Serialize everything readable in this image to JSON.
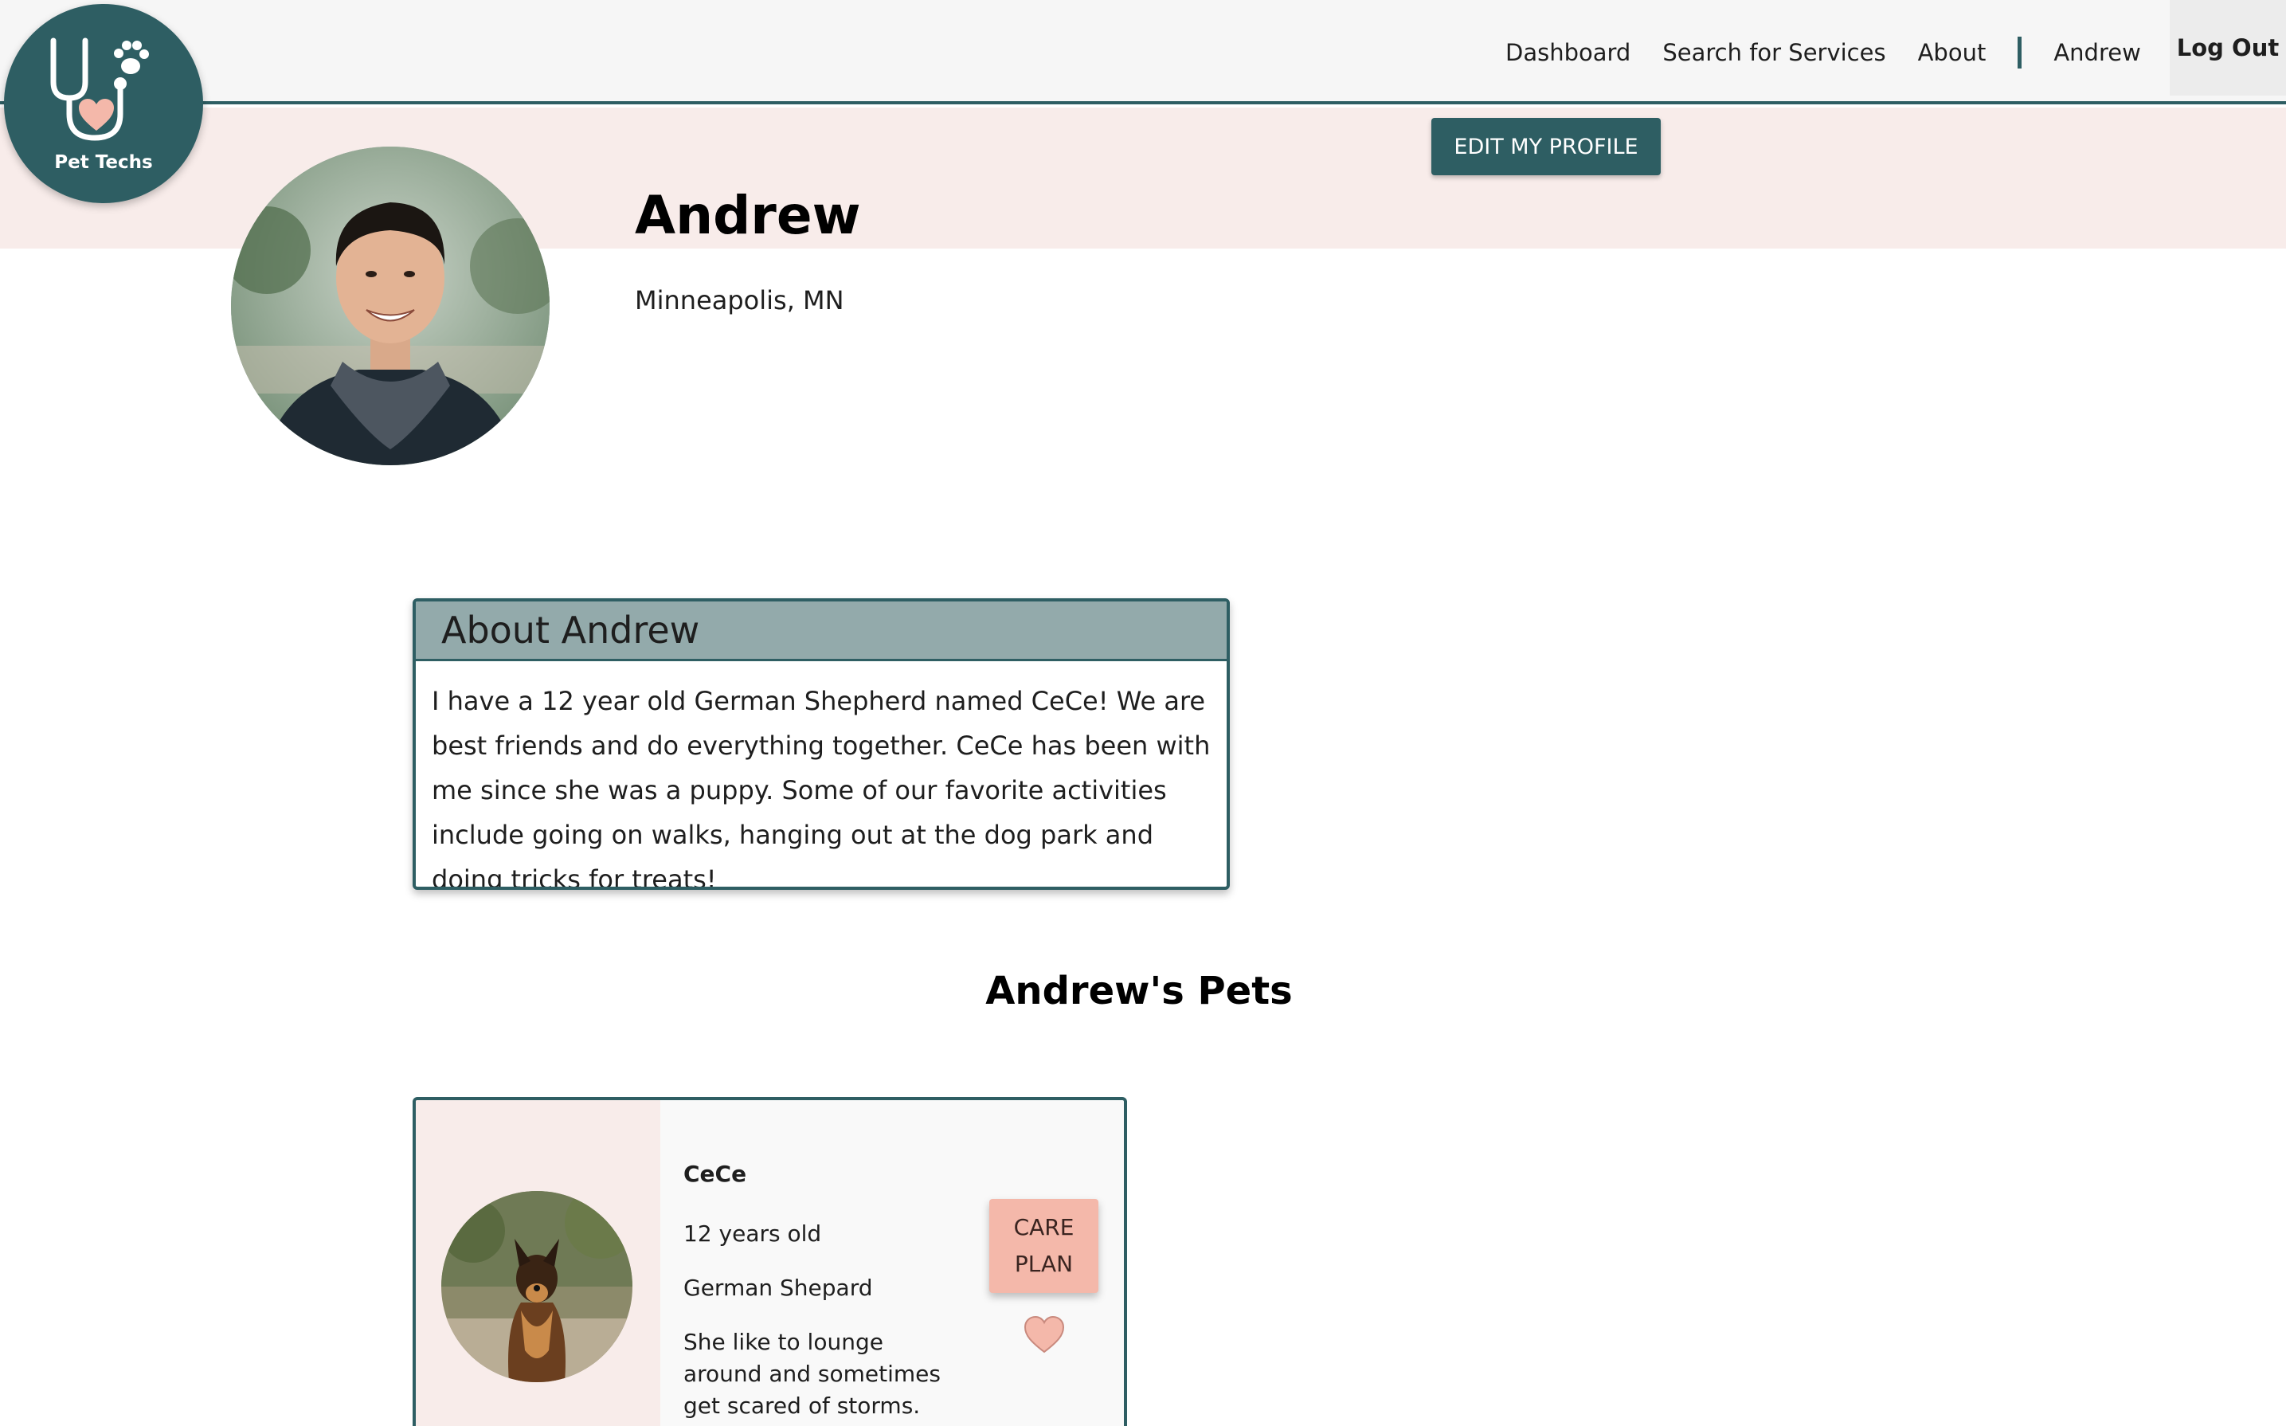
{
  "brand": {
    "name": "Pet Techs"
  },
  "nav": {
    "links": [
      "Dashboard",
      "Search for Services",
      "About"
    ],
    "user": "Andrew",
    "logout": "Log Out"
  },
  "profile": {
    "edit_button": "EDIT MY PROFILE",
    "name": "Andrew",
    "location": "Minneapolis, MN"
  },
  "about": {
    "heading": "About Andrew",
    "body": "I have a 12 year old German Shepherd named CeCe! We are best friends and do everything together. CeCe has been with me since she was a puppy. Some of our favorite activities include going on walks, hanging out at the dog park and doing tricks for treats!"
  },
  "pets": {
    "heading": "Andrew's Pets",
    "items": [
      {
        "name": "CeCe",
        "age": "12 years old",
        "breed": "German Shepard",
        "description": "She like to lounge around and sometimes get scared of storms.",
        "care_plan_line1": "CARE",
        "care_plan_line2": "PLAN"
      }
    ]
  },
  "colors": {
    "primary": "#2e5e63",
    "banner": "#f8ecea",
    "about_header": "#93aaab",
    "accent": "#f4b8aa"
  },
  "icons": [
    "stethoscope-logo-icon",
    "paw-icon",
    "heart-icon"
  ]
}
